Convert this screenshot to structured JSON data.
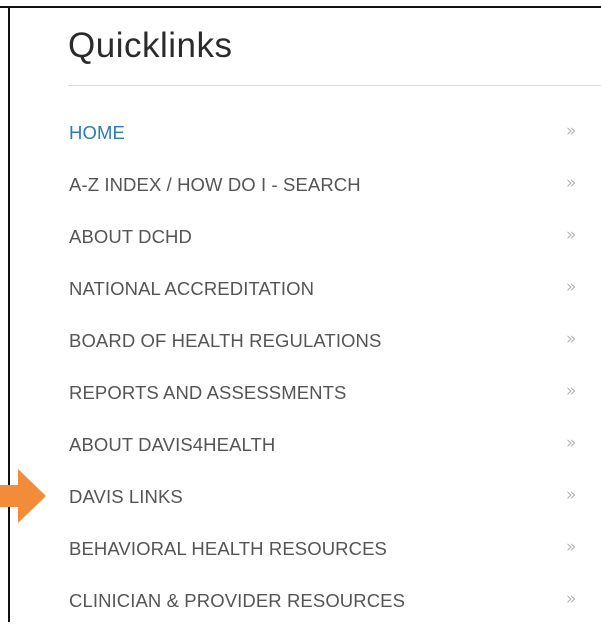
{
  "quicklinks": {
    "title": "Quicklinks",
    "chevron": "»",
    "items": [
      {
        "label": "HOME",
        "active": true
      },
      {
        "label": "A-Z INDEX / HOW DO I - SEARCH",
        "active": false
      },
      {
        "label": "ABOUT DCHD",
        "active": false
      },
      {
        "label": "NATIONAL ACCREDITATION",
        "active": false
      },
      {
        "label": "BOARD OF HEALTH REGULATIONS",
        "active": false
      },
      {
        "label": "REPORTS AND ASSESSMENTS",
        "active": false
      },
      {
        "label": "ABOUT DAVIS4HEALTH",
        "active": false
      },
      {
        "label": "DAVIS LINKS",
        "active": false
      },
      {
        "label": "BEHAVIORAL HEALTH RESOURCES",
        "active": false
      },
      {
        "label": "CLINICIAN & PROVIDER RESOURCES",
        "active": false
      }
    ]
  },
  "colors": {
    "active_link": "#2a7bbd",
    "link": "#555555",
    "chevron": "#b5b5b5",
    "annotation_arrow": "#f28c3a"
  },
  "annotation": {
    "icon": "orange-pointer-arrow-icon",
    "points_to": "DAVIS LINKS"
  }
}
